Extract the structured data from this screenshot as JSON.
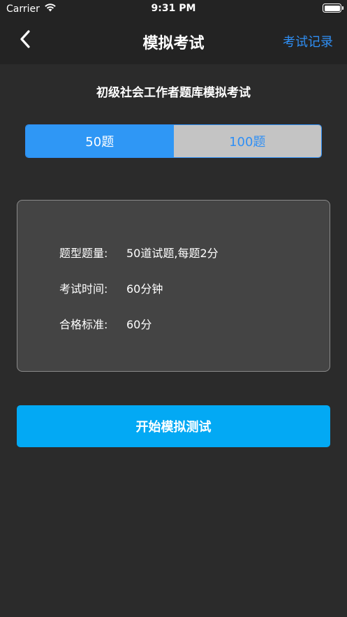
{
  "status_bar": {
    "carrier": "Carrier",
    "time": "9:31 PM"
  },
  "nav": {
    "title": "模拟考试",
    "right_link": "考试记录",
    "accent_color": "#2f8ff5"
  },
  "exam_name": "初级社会工作者题库模拟考试",
  "segment": {
    "options": [
      "50题",
      "100题"
    ],
    "selected": "50题"
  },
  "info": {
    "rows": [
      {
        "label": "题型题量:",
        "value": "50道试题,每题2分"
      },
      {
        "label": "考试时间:",
        "value": "60分钟"
      },
      {
        "label": "合格标准:",
        "value": "60分"
      }
    ]
  },
  "start_button": {
    "label": "开始模拟测试",
    "color": "#03a9f4"
  }
}
